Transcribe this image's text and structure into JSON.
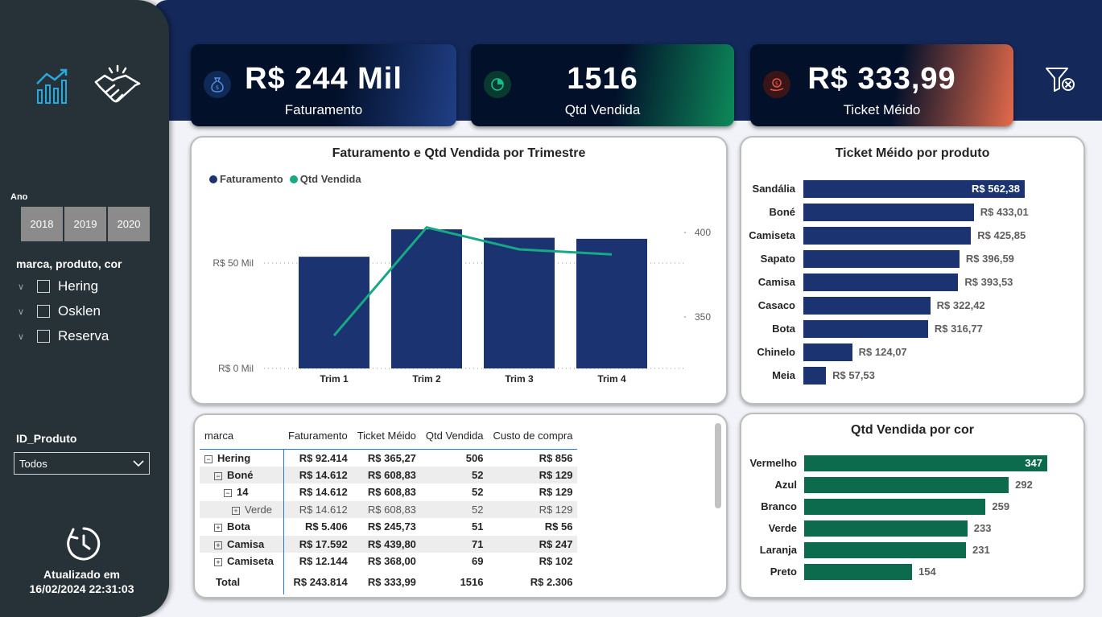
{
  "sidebar": {
    "ano_label": "Ano",
    "years": [
      "2018",
      "2019",
      "2020"
    ],
    "brand_slicer_title": "marca, produto, cor",
    "brands": [
      "Hering",
      "Osklen",
      "Reserva"
    ],
    "id_slicer_title": "ID_Produto",
    "id_selected": "Todos",
    "updated_label": "Atualizado em",
    "updated_at": "16/02/2024 22:31:03"
  },
  "kpis": [
    {
      "value": "R$ 244 Mil",
      "label": "Faturamento",
      "icon": "money-bag-icon"
    },
    {
      "value": "1516",
      "label": "Qtd Vendida",
      "icon": "pie-chart-icon"
    },
    {
      "value": "R$ 333,99",
      "label": "Ticket Méido",
      "icon": "dollar-hand-icon"
    }
  ],
  "colors": {
    "navy": "#14285a",
    "bar_blue": "#1b3370",
    "green": "#17a884",
    "bar_green": "#0b6b4c",
    "sidebar": "#263238"
  },
  "charts": {
    "combo_title": "Faturamento e Qtd Vendida por Trimestre",
    "ticket_title": "Ticket Méido por produto",
    "cor_title": "Qtd Vendida por cor"
  },
  "chart_data": [
    {
      "type": "bar",
      "title": "Faturamento e Qtd Vendida por Trimestre",
      "categories": [
        "Trim 1",
        "Trim 2",
        "Trim 3",
        "Trim 4"
      ],
      "series": [
        {
          "name": "Faturamento",
          "values": [
            53,
            66,
            62,
            61.5
          ],
          "axis": "left"
        },
        {
          "name": "Qtd Vendida",
          "values": [
            339,
            403,
            390,
            387
          ],
          "axis": "right",
          "render": "line"
        }
      ],
      "left_ticks": [
        "R$ 0 Mil",
        "R$ 50 Mil"
      ],
      "right_ticks": [
        "350",
        "400"
      ],
      "left_range": [
        0,
        50
      ],
      "right_range": [
        350,
        400
      ],
      "legend": "top-left"
    },
    {
      "type": "bar",
      "orientation": "horizontal",
      "title": "Ticket Méido por produto",
      "categories": [
        "Sandália",
        "Boné",
        "Camiseta",
        "Sapato",
        "Camisa",
        "Casaco",
        "Bota",
        "Chinelo",
        "Meia"
      ],
      "values": [
        562.38,
        433.01,
        425.85,
        396.59,
        393.53,
        322.42,
        316.77,
        124.07,
        57.53
      ],
      "labels": [
        "R$ 562,38",
        "R$ 433,01",
        "R$ 425,85",
        "R$ 396,59",
        "R$ 393,53",
        "R$ 322,42",
        "R$ 316,77",
        "R$ 124,07",
        "R$ 57,53"
      ]
    },
    {
      "type": "bar",
      "orientation": "horizontal",
      "title": "Qtd Vendida por cor",
      "categories": [
        "Vermelho",
        "Azul",
        "Branco",
        "Verde",
        "Laranja",
        "Preto"
      ],
      "values": [
        347,
        292,
        259,
        233,
        231,
        154
      ],
      "labels": [
        "347",
        "292",
        "259",
        "233",
        "231",
        "154"
      ]
    }
  ],
  "matrix": {
    "headers": [
      "marca",
      "Faturamento",
      "Ticket Méido",
      "Qtd Vendida",
      "Custo de compra"
    ],
    "rows": [
      {
        "level": 0,
        "exp": "−",
        "name": "Hering",
        "cells": [
          "R$ 92.414",
          "R$ 365,27",
          "506",
          "R$ 856"
        ]
      },
      {
        "level": 1,
        "exp": "−",
        "name": "Boné",
        "cells": [
          "R$ 14.612",
          "R$ 608,83",
          "52",
          "R$ 129"
        ]
      },
      {
        "level": 2,
        "exp": "−",
        "name": "14",
        "cells": [
          "R$ 14.612",
          "R$ 608,83",
          "52",
          "R$ 129"
        ]
      },
      {
        "level": 3,
        "exp": "+",
        "name": "Verde",
        "cells": [
          "R$ 14.612",
          "R$ 608,83",
          "52",
          "R$ 129"
        ]
      },
      {
        "level": 1,
        "exp": "+",
        "name": "Bota",
        "cells": [
          "R$ 5.406",
          "R$ 245,73",
          "51",
          "R$ 56"
        ]
      },
      {
        "level": 1,
        "exp": "+",
        "name": "Camisa",
        "cells": [
          "R$ 17.592",
          "R$ 439,80",
          "71",
          "R$ 247"
        ]
      },
      {
        "level": 1,
        "exp": "+",
        "name": "Camiseta",
        "cells": [
          "R$ 12.144",
          "R$ 368,00",
          "69",
          "R$ 102"
        ]
      }
    ],
    "total": {
      "name": "Total",
      "cells": [
        "R$ 243.814",
        "R$ 333,99",
        "1516",
        "R$ 2.306"
      ]
    }
  }
}
